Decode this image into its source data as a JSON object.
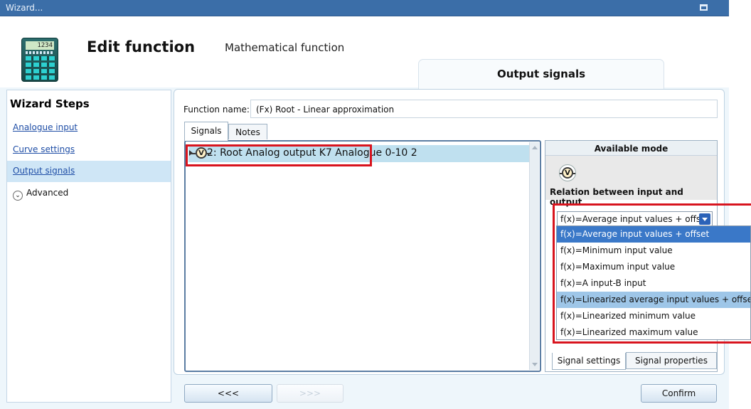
{
  "window": {
    "title": "Wizard..."
  },
  "header": {
    "title": "Edit function",
    "function_type": "Mathematical function",
    "section_tab": "Output signals",
    "calculator_display": "1234"
  },
  "sidebar": {
    "title": "Wizard Steps",
    "steps": [
      {
        "label": "Analogue input",
        "link": true
      },
      {
        "label": "Curve settings",
        "link": true
      },
      {
        "label": "Output signals",
        "link": true,
        "active": true
      },
      {
        "label": "Advanced",
        "link": false
      }
    ]
  },
  "form": {
    "function_name_label": "Function name:",
    "function_name_value": "(Fx) Root - Linear approximation"
  },
  "tabs": [
    "Signals",
    "Notes"
  ],
  "signals": [
    {
      "label": "2: Root Analog output K7 Analogue 0-10 2",
      "icon": "V"
    }
  ],
  "available_mode": {
    "title": "Available mode",
    "mode_icon": "V",
    "relation_label": "Relation between input and output",
    "selected": "f(x)=Average input values + offset",
    "options": [
      "f(x)=Average input values + offset",
      "f(x)=Minimum input value",
      "f(x)=Maximum input value",
      "f(x)=A input-B input",
      "f(x)=Linearized average input values + offset",
      "f(x)=Linearized minimum  value",
      "f(x)=Linearized maximum  value"
    ]
  },
  "bottom_tabs": [
    "Signal settings",
    "Signal properties"
  ],
  "nav": {
    "back": "<<<",
    "next": ">>>",
    "confirm": "Confirm"
  },
  "colors": {
    "titlebar": "#3b6ea8",
    "highlight_box": "#d8141e",
    "selected_option": "#3a78c8"
  }
}
